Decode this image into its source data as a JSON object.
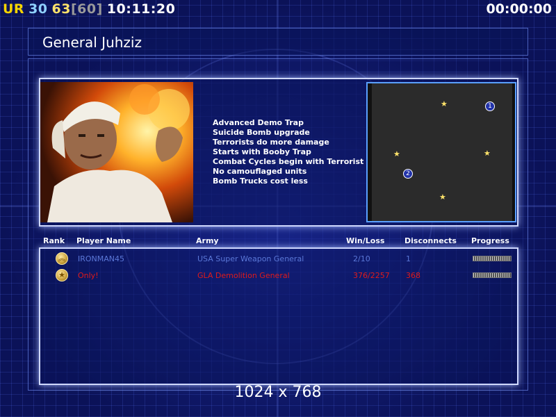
{
  "hud": {
    "left": [
      {
        "text": "UR",
        "color": "#f5d400"
      },
      {
        "text": "30",
        "color": "#8fd1ff"
      },
      {
        "text": "63",
        "color": "#ffe26a"
      },
      {
        "text": "[60]",
        "color": "#9a9a9a"
      },
      {
        "text": "10:11:20",
        "color": "#ffffff"
      }
    ],
    "timer": "00:00:00"
  },
  "general": {
    "title": "General Juhziz",
    "bonuses": [
      "Advanced Demo Trap",
      "Suicide Bomb upgrade",
      "Terrorists do more damage",
      "Starts with Booby Trap",
      "Combat Cycles begin with Terrorist",
      "No camouflaged units",
      "Bomb Trucks cost less"
    ]
  },
  "map": {
    "slot_labels": [
      "1",
      "2"
    ],
    "star_icon": "star-icon",
    "star_color": "#ffe36a"
  },
  "table": {
    "headers": {
      "rank": "Rank",
      "player": "Player Name",
      "army": "Army",
      "winloss": "Win/Loss",
      "disconnects": "Disconnects",
      "progress": "Progress"
    },
    "rows": [
      {
        "rank_icon": "chevron-rank-icon",
        "player": "IRONMAN45",
        "army": "USA Super Weapon General",
        "winloss": "2/10",
        "disconnects": "1",
        "color": "#5b78d8"
      },
      {
        "rank_icon": "star-rank-icon",
        "player": "Only!",
        "army": "GLA Demolition General",
        "winloss": "376/2257",
        "disconnects": "368",
        "color": "#e01a1a"
      }
    ]
  },
  "resolution": "1024 x 768"
}
